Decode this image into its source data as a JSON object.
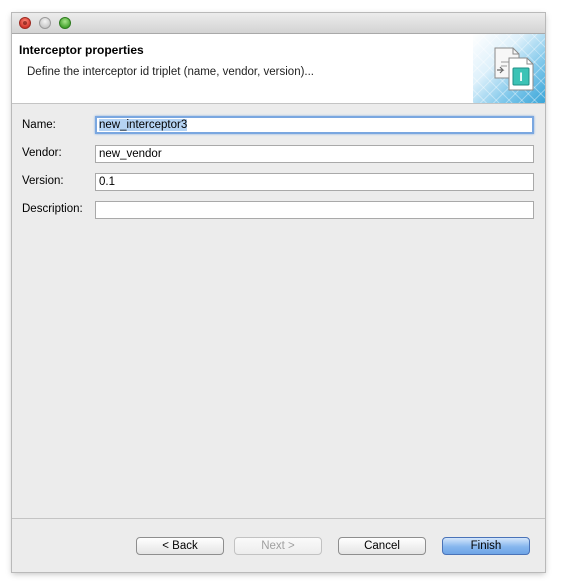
{
  "window": {
    "controls": [
      "close-icon",
      "minimize-icon",
      "zoom-icon"
    ]
  },
  "banner": {
    "title": "Interceptor properties",
    "description": "Define the interceptor id triplet (name, vendor, version)...",
    "icon_letter": "I",
    "icon": "interceptor-wizard-icon"
  },
  "form": {
    "name_label": "Name:",
    "name_value": "new_interceptor3",
    "vendor_label": "Vendor:",
    "vendor_value": "new_vendor",
    "version_label": "Version:",
    "version_value": "0.1",
    "description_label": "Description:",
    "description_value": ""
  },
  "buttons": {
    "back": "< Back",
    "next": "Next >",
    "cancel": "Cancel",
    "finish": "Finish"
  },
  "colors": {
    "focus_ring": "#7aa7e0",
    "selection": "#b5d3f3",
    "default_button": "#86b6ee",
    "banner_accent": "#3aa5d8"
  }
}
